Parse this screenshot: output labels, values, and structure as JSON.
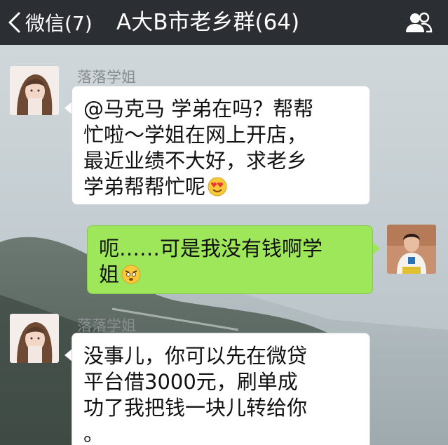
{
  "nav": {
    "back_label": "微信(7)",
    "title": "A大B市老乡群(64)",
    "back_icon": "chevron-left-icon",
    "contacts_icon": "group-members-icon"
  },
  "colors": {
    "navbar": "#2b2f33",
    "incoming_bubble": "#ffffff",
    "outgoing_bubble": "#9fe75a"
  },
  "messages": [
    {
      "sender": "落落学姐",
      "direction": "incoming",
      "lines": [
        "@马克马 学弟在吗？帮帮",
        "忙啦～学姐在网上开店，",
        "最近业绩不大好，求老乡",
        "学弟帮帮忙呢"
      ],
      "emoji": "heart-eyes-emoji"
    },
    {
      "sender": "",
      "direction": "outgoing",
      "lines": [
        "呃……可是我没有钱啊学",
        "姐"
      ],
      "emoji": "annoyed-emoji"
    },
    {
      "sender": "落落学姐",
      "direction": "incoming",
      "lines": [
        "没事儿，你可以先在微贷",
        "平台借3000元，刷单成",
        "功了我把钱一块儿转给你",
        "。"
      ],
      "emoji": ""
    }
  ]
}
